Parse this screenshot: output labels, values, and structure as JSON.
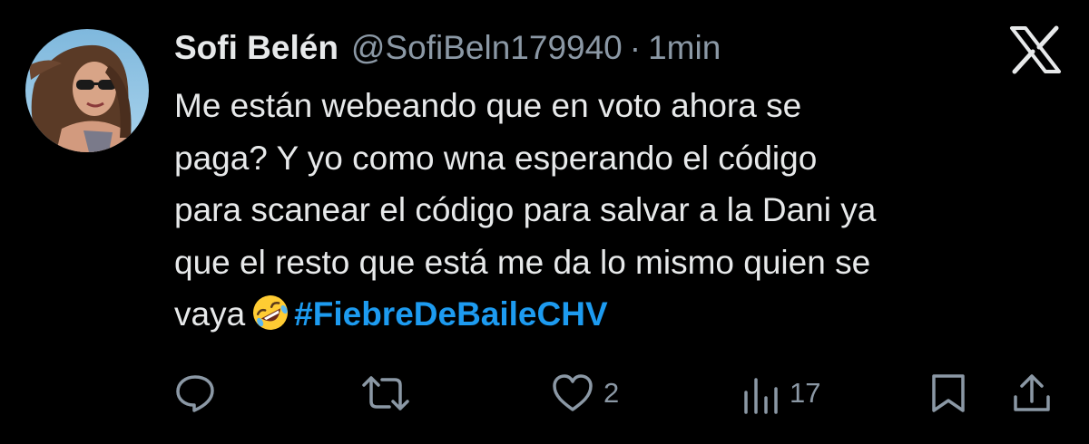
{
  "author": {
    "display_name": "Sofi Belén",
    "handle": "@SofiBeln179940",
    "separator": "·",
    "time": "1min"
  },
  "tweet": {
    "lines": [
      "Me están webeando que en voto ahora se",
      "paga? Y yo como wna esperando el código",
      "para scanear el código para salvar a la Dani ya",
      "que el resto que está me da lo mismo quien se",
      "vaya"
    ],
    "emoji": "rolling-on-the-floor-laughing",
    "hashtag": "#FiebreDeBaileCHV"
  },
  "actions": {
    "reply_count": "",
    "retweet_count": "",
    "like_count": "2",
    "views_count": "17"
  },
  "icons": {
    "reply": "reply-icon",
    "retweet": "retweet-icon",
    "like": "heart-icon",
    "views": "views-icon",
    "bookmark": "bookmark-icon",
    "share": "share-icon",
    "logo": "x-logo-icon"
  },
  "colors": {
    "background": "#000000",
    "text": "#e7e9ea",
    "muted": "#8b98a5",
    "accent": "#1d9bf0"
  }
}
